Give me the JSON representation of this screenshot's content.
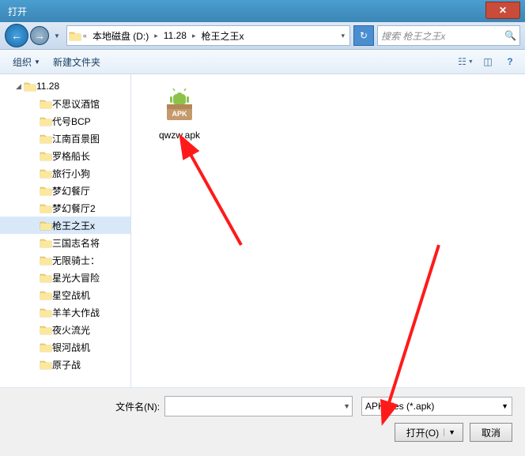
{
  "window": {
    "title": "打开"
  },
  "nav": {
    "path_root": "本地磁盘 (D:)",
    "path_seg1": "11.28",
    "path_seg2": "枪王之王x",
    "search_placeholder": "搜索 枪王之王x"
  },
  "toolbar": {
    "organize": "组织",
    "new_folder": "新建文件夹"
  },
  "tree": {
    "root": "11.28",
    "items": [
      "不思议酒馆",
      "代号BCP",
      "江南百景图",
      "罗格船长",
      "旅行小狗",
      "梦幻餐厅",
      "梦幻餐厅2",
      "枪王之王x",
      "三国志名将",
      "无限骑士：",
      "星光大冒险",
      "星空战机",
      "羊羊大作战",
      "夜火流光",
      "银河战机",
      "原子战"
    ],
    "selected_index": 7
  },
  "content": {
    "file_name": "qwzw.apk",
    "icon_label": "APK"
  },
  "bottom": {
    "filename_label": "文件名(N):",
    "filename_value": "",
    "filetype_value": "APK files (*.apk)",
    "open": "打开(O)",
    "cancel": "取消"
  }
}
